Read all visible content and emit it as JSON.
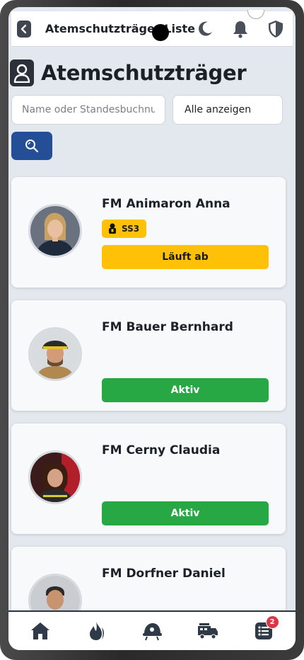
{
  "topbar": {
    "title": "Atemschutzträger Liste",
    "icons": [
      "back-icon",
      "moon-icon",
      "bell-icon",
      "shield-icon"
    ]
  },
  "page": {
    "title": "Atemschutzträger",
    "icon": "user-icon"
  },
  "filters": {
    "search_placeholder": "Name oder Standesbuchnummer",
    "select_value": "Alle anzeigen",
    "search_button_icon": "search-icon"
  },
  "cards": [
    {
      "name": "FM Animaron Anna",
      "qualification": "SS3",
      "status": "Läuft ab"
    },
    {
      "name": "FM Bauer Bernhard",
      "status": "Aktiv"
    },
    {
      "name": "FM Cerny Claudia",
      "status": "Aktiv"
    },
    {
      "name": "FM Dorfner Daniel"
    }
  ],
  "bottom_nav": {
    "items": [
      "home-icon",
      "fire-icon",
      "helmet-icon",
      "truck-icon",
      "list-icon"
    ],
    "badge": "2"
  },
  "colors": {
    "primary": "#244f96",
    "warning": "#ffc107",
    "success": "#28a745",
    "badge": "#dc3545",
    "background": "#e3e8ef"
  }
}
